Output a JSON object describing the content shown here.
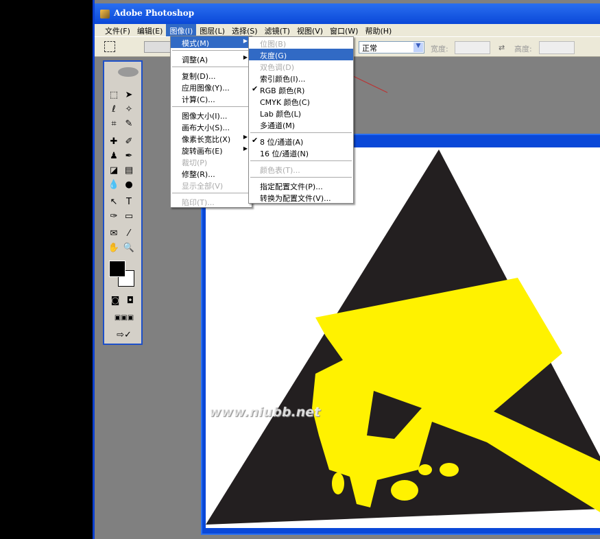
{
  "window": {
    "title": "Adobe Photoshop"
  },
  "menubar": [
    "文件(F)",
    "编辑(E)",
    "图像(I)",
    "图层(L)",
    "选择(S)",
    "滤镜(T)",
    "视图(V)",
    "窗口(W)",
    "帮助(H)"
  ],
  "options": {
    "mode_value": "正常",
    "width_label": "宽度:",
    "height_label": "高度:"
  },
  "image_menu": [
    {
      "label": "模式(M)",
      "sub": true,
      "hl": true
    },
    {
      "sep": true
    },
    {
      "label": "调整(A)",
      "sub": true
    },
    {
      "sep": true
    },
    {
      "label": "复制(D)..."
    },
    {
      "label": "应用图像(Y)..."
    },
    {
      "label": "计算(C)..."
    },
    {
      "sep": true
    },
    {
      "label": "图像大小(I)..."
    },
    {
      "label": "画布大小(S)..."
    },
    {
      "label": "像素长宽比(X)",
      "sub": true
    },
    {
      "label": "旋转画布(E)",
      "sub": true
    },
    {
      "label": "裁切(P)",
      "dis": true
    },
    {
      "label": "修整(R)..."
    },
    {
      "label": "显示全部(V)",
      "dis": true
    },
    {
      "sep": true
    },
    {
      "label": "陷印(T)...",
      "dis": true
    }
  ],
  "mode_menu": [
    {
      "label": "位图(B)",
      "dis": true
    },
    {
      "label": "灰度(G)",
      "hl": true
    },
    {
      "label": "双色调(D)",
      "dis": true
    },
    {
      "label": "索引颜色(I)..."
    },
    {
      "label": "RGB 颜色(R)",
      "chk": true
    },
    {
      "label": "CMYK 颜色(C)"
    },
    {
      "label": "Lab 颜色(L)"
    },
    {
      "label": "多通道(M)"
    },
    {
      "sep": true
    },
    {
      "label": "8 位/通道(A)",
      "chk": true
    },
    {
      "label": "16 位/通道(N)"
    },
    {
      "sep": true
    },
    {
      "label": "颜色表(T)...",
      "dis": true
    },
    {
      "sep": true
    },
    {
      "label": "指定配置文件(P)..."
    },
    {
      "label": "转换为配置文件(V)..."
    }
  ],
  "watermark": "www.niubb.net",
  "colors": {
    "titlebar": "#0a48d8",
    "highlight": "#316ac5",
    "sign_yellow": "#fff200",
    "sign_black": "#231f20"
  }
}
